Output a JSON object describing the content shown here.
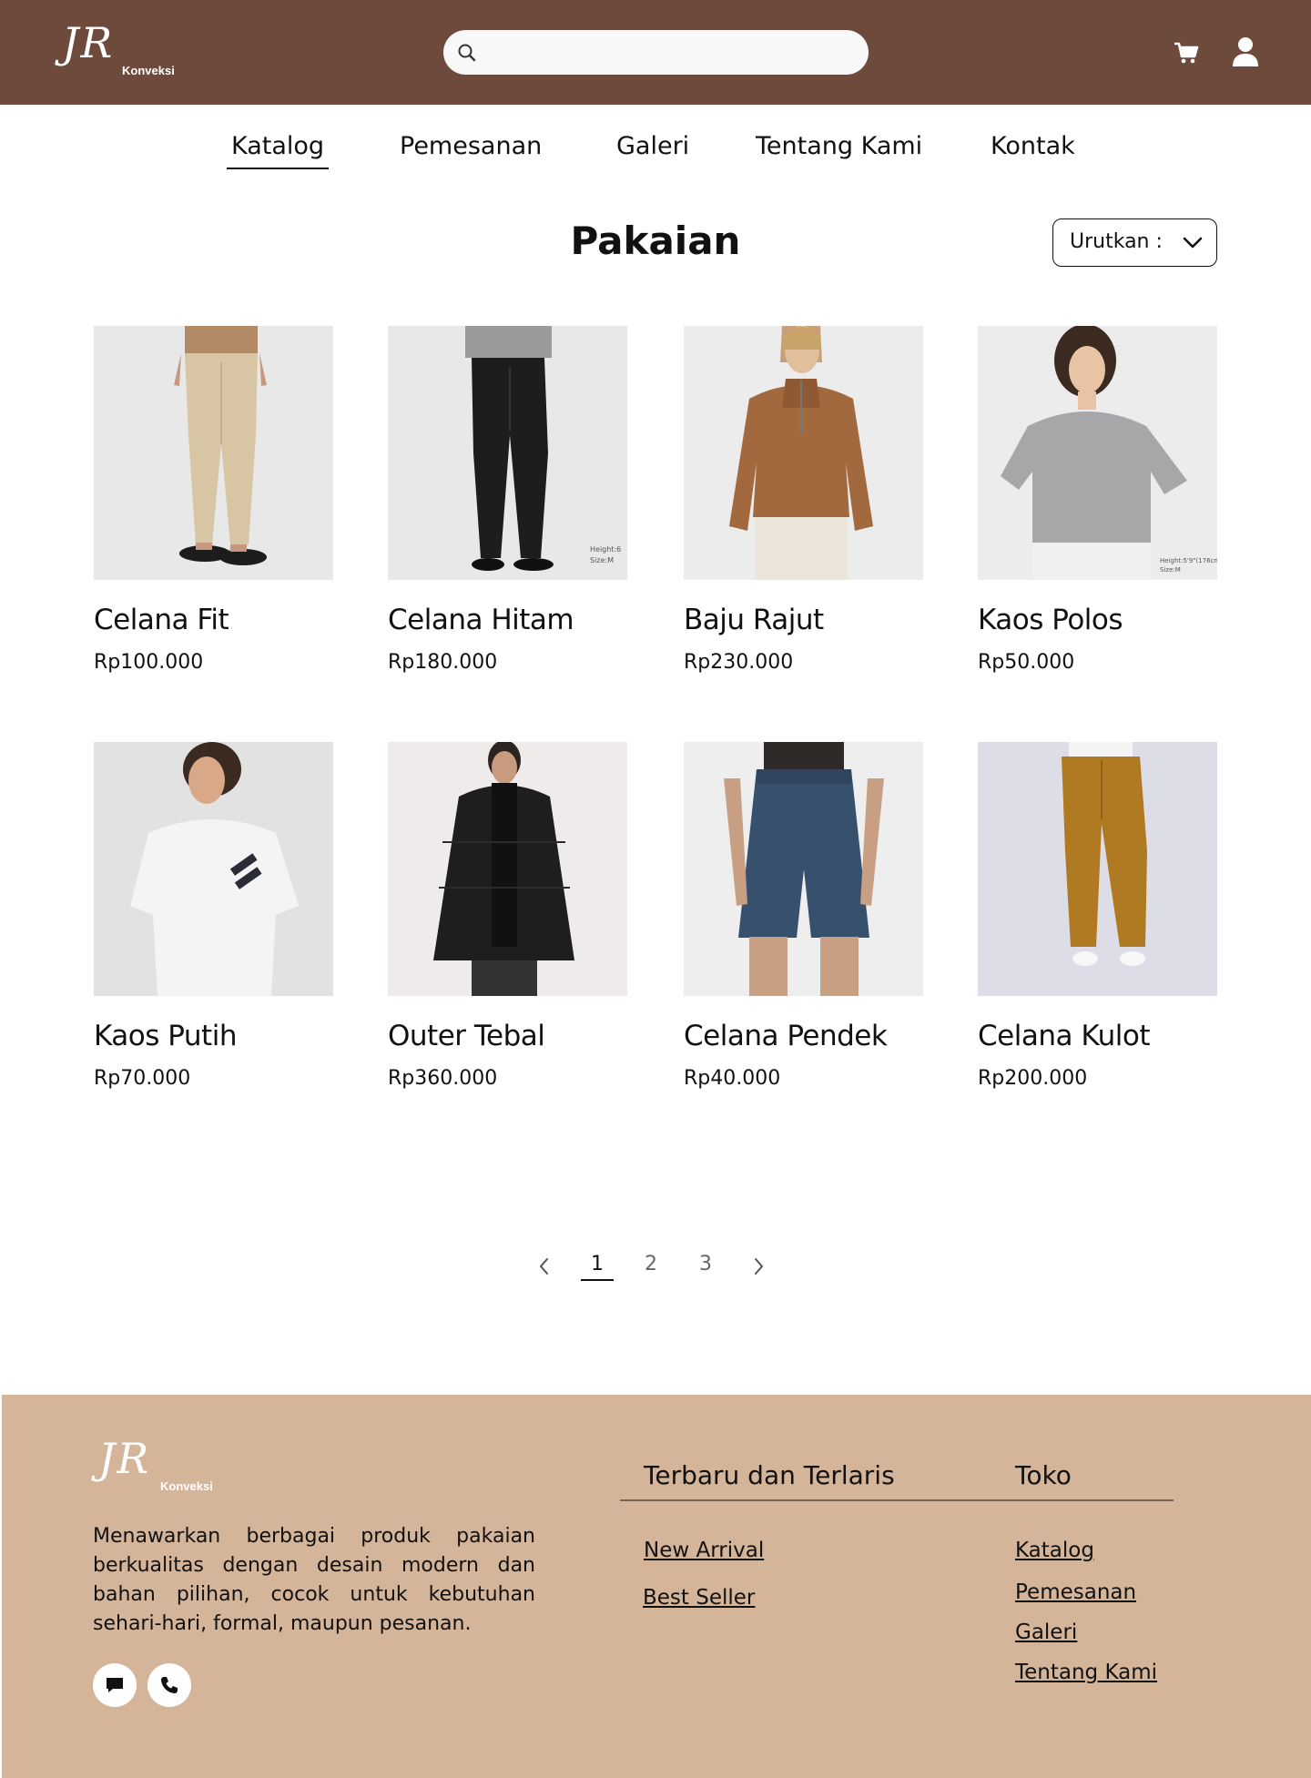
{
  "header": {
    "logo_script": "JR",
    "logo_sub": "Konveksi",
    "search_placeholder": "",
    "icons": {
      "search": "search-icon",
      "cart": "cart-icon",
      "user": "user-icon"
    }
  },
  "nav": {
    "items": [
      {
        "label": "Katalog",
        "active": true
      },
      {
        "label": "Pemesanan",
        "active": false
      },
      {
        "label": "Galeri",
        "active": false
      },
      {
        "label": "Tentang Kami",
        "active": false
      },
      {
        "label": "Kontak",
        "active": false
      }
    ]
  },
  "main": {
    "title": "Pakaian",
    "sort_label": "Urutkan :"
  },
  "products": [
    {
      "name": "Celana Fit",
      "price": "Rp100.000",
      "image": "beige-trousers-photo"
    },
    {
      "name": "Celana Hitam",
      "price": "Rp180.000",
      "image": "black-trousers-photo",
      "image_caption": [
        "Height:6",
        "Size:M"
      ]
    },
    {
      "name": "Baju Rajut",
      "price": "Rp230.000",
      "image": "brown-knit-sweater-photo"
    },
    {
      "name": "Kaos Polos",
      "price": "Rp50.000",
      "image": "grey-tshirt-photo",
      "image_caption": [
        "Height:5'9\"(176cm",
        "Size:M"
      ]
    },
    {
      "name": "Kaos Putih",
      "price": "Rp70.000",
      "image": "white-tshirt-photo"
    },
    {
      "name": "Outer Tebal",
      "price": "Rp360.000",
      "image": "black-puffer-coat-photo"
    },
    {
      "name": "Celana Pendek",
      "price": "Rp40.000",
      "image": "denim-shorts-photo"
    },
    {
      "name": "Celana Kulot",
      "price": "Rp200.000",
      "image": "mustard-culottes-photo"
    }
  ],
  "pagination": {
    "pages": [
      "1",
      "2",
      "3"
    ],
    "current": "1"
  },
  "footer": {
    "logo_script": "JR",
    "logo_sub": "Konveksi",
    "description": "Menawarkan berbagai produk pakaian berkualitas dengan desain modern dan bahan pilihan, cocok untuk kebutuhan sehari-hari, formal, maupun pesanan.",
    "col1_title": "Terbaru dan Terlaris",
    "col1_links": [
      "New Arrival",
      "Best Seller"
    ],
    "col2_title": "Toko",
    "col2_links": [
      "Katalog",
      "Pemesanan",
      "Galeri",
      "Tentang Kami"
    ],
    "social_icons": [
      "chat-icon",
      "phone-icon"
    ]
  },
  "colors": {
    "header_bg": "#6d4a3c",
    "footer_bg": "#d4b59a"
  }
}
